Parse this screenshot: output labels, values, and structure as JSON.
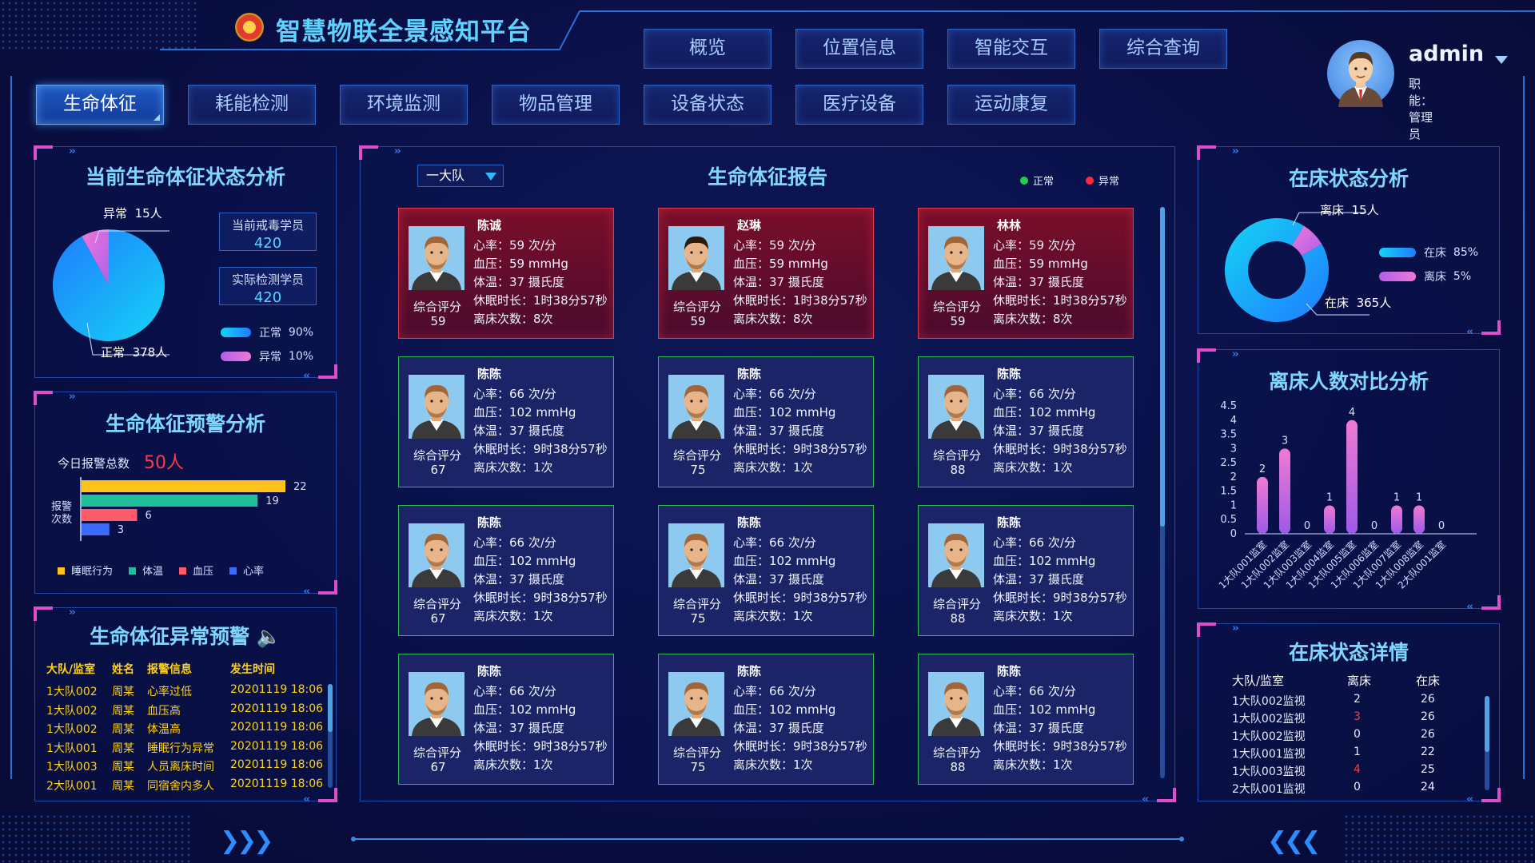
{
  "header": {
    "title": "智慧物联全景感知平台",
    "top_nav": [
      "概览",
      "位置信息",
      "智能交互",
      "综合查询"
    ],
    "sub_nav": [
      "生命体征",
      "耗能检测",
      "环境监测",
      "物品管理",
      "设备状态",
      "医疗设备",
      "运动康复"
    ],
    "active_tab": "生命体征"
  },
  "user": {
    "name": "admin",
    "role": "职能：管理员"
  },
  "vital_status": {
    "title": "当前生命体征状态分析",
    "abnormal_label": "异常",
    "abnormal_count": "15人",
    "normal_label": "正常",
    "normal_count": "378人",
    "box1_label": "当前戒毒学员",
    "box1_value": "420",
    "box2_label": "实际检测学员",
    "box2_value": "420",
    "legend": [
      {
        "name": "正常",
        "pct": "90%"
      },
      {
        "name": "异常",
        "pct": "10%"
      }
    ],
    "colors": {
      "normal": "#1aa4ff",
      "abnormal": "#d96bd6"
    }
  },
  "warning": {
    "title": "生命体征预警分析",
    "total_label": "今日报警总数",
    "total_value": "50人",
    "ylabel": "报警\n次数",
    "legend": [
      "睡眠行为",
      "体温",
      "血压",
      "心率"
    ]
  },
  "alerts": {
    "title": "生命体征异常预警",
    "headers": [
      "大队/监室",
      "姓名",
      "报警信息",
      "发生时间"
    ],
    "rows": [
      [
        "1大队002",
        "周某",
        "心率过低",
        "20201119 18:06"
      ],
      [
        "1大队002",
        "周某",
        "血压高",
        "20201119 18:06"
      ],
      [
        "1大队002",
        "周某",
        "体温高",
        "20201119 18:06"
      ],
      [
        "1大队001",
        "周某",
        "睡眠行为异常",
        "20201119 18:06"
      ],
      [
        "1大队003",
        "周某",
        "人员离床时间",
        "20201119 18:06"
      ],
      [
        "2大队001",
        "周某",
        "同宿舍内多人",
        "20201119 18:06"
      ]
    ]
  },
  "report": {
    "title": "生命体征报告",
    "team_select": "一大队",
    "legend_normal": "正常",
    "legend_abnormal": "异常",
    "cards": [
      {
        "name": "陈诚",
        "hr": "心率：59  次/分",
        "bp": "血压：59  mmHg",
        "temp": "体温：37  摄氏度",
        "sleep": "休眠时长：1时38分57秒",
        "leave": "离床次数：8次",
        "score_label": "综合评分",
        "score": "59",
        "status": "abn"
      },
      {
        "name": "赵琳",
        "hr": "心率：59  次/分",
        "bp": "血压：59  mmHg",
        "temp": "体温：37  摄氏度",
        "sleep": "休眠时长：1时38分57秒",
        "leave": "离床次数：8次",
        "score_label": "综合评分",
        "score": "59",
        "status": "abn"
      },
      {
        "name": "林林",
        "hr": "心率：59  次/分",
        "bp": "血压：59  mmHg",
        "temp": "体温：37  摄氏度",
        "sleep": "休眠时长：1时38分57秒",
        "leave": "离床次数：8次",
        "score_label": "综合评分",
        "score": "59",
        "status": "abn"
      },
      {
        "name": "陈陈",
        "hr": "心率：66  次/分",
        "bp": "血压：102  mmHg",
        "temp": "体温：37  摄氏度",
        "sleep": "休眠时长：9时38分57秒",
        "leave": "离床次数：1次",
        "score_label": "综合评分",
        "score": "67",
        "status": "norm"
      },
      {
        "name": "陈陈",
        "hr": "心率：66  次/分",
        "bp": "血压：102  mmHg",
        "temp": "体温：37  摄氏度",
        "sleep": "休眠时长：9时38分57秒",
        "leave": "离床次数：1次",
        "score_label": "综合评分",
        "score": "75",
        "status": "norm"
      },
      {
        "name": "陈陈",
        "hr": "心率：66  次/分",
        "bp": "血压：102  mmHg",
        "temp": "体温：37  摄氏度",
        "sleep": "休眠时长：9时38分57秒",
        "leave": "离床次数：1次",
        "score_label": "综合评分",
        "score": "88",
        "status": "norm"
      },
      {
        "name": "陈陈",
        "hr": "心率：66  次/分",
        "bp": "血压：102  mmHg",
        "temp": "体温：37  摄氏度",
        "sleep": "休眠时长：9时38分57秒",
        "leave": "离床次数：1次",
        "score_label": "综合评分",
        "score": "67",
        "status": "norm"
      },
      {
        "name": "陈陈",
        "hr": "心率：66  次/分",
        "bp": "血压：102  mmHg",
        "temp": "体温：37  摄氏度",
        "sleep": "休眠时长：9时38分57秒",
        "leave": "离床次数：1次",
        "score_label": "综合评分",
        "score": "75",
        "status": "norm"
      },
      {
        "name": "陈陈",
        "hr": "心率：66  次/分",
        "bp": "血压：102  mmHg",
        "temp": "体温：37  摄氏度",
        "sleep": "休眠时长：9时38分57秒",
        "leave": "离床次数：1次",
        "score_label": "综合评分",
        "score": "88",
        "status": "norm"
      },
      {
        "name": "陈陈",
        "hr": "心率：66  次/分",
        "bp": "血压：102  mmHg",
        "temp": "体温：37  摄氏度",
        "sleep": "休眠时长：9时38分57秒",
        "leave": "离床次数：1次",
        "score_label": "综合评分",
        "score": "67",
        "status": "norm"
      },
      {
        "name": "陈陈",
        "hr": "心率：66  次/分",
        "bp": "血压：102  mmHg",
        "temp": "体温：37  摄氏度",
        "sleep": "休眠时长：9时38分57秒",
        "leave": "离床次数：1次",
        "score_label": "综合评分",
        "score": "75",
        "status": "norm"
      },
      {
        "name": "陈陈",
        "hr": "心率：66  次/分",
        "bp": "血压：102  mmHg",
        "temp": "体温：37  摄氏度",
        "sleep": "休眠时长：9时38分57秒",
        "leave": "离床次数：1次",
        "score_label": "综合评分",
        "score": "88",
        "status": "norm"
      }
    ]
  },
  "bed_status": {
    "title": "在床状态分析",
    "leave_label": "离床",
    "leave_count": "15人",
    "inbed_label": "在床",
    "inbed_count": "365人",
    "legend": [
      {
        "name": "在床",
        "pct": "85%"
      },
      {
        "name": "离床",
        "pct": "5%"
      }
    ]
  },
  "leave_compare": {
    "title": "离床人数对比分析"
  },
  "bed_detail": {
    "title": "在床状态详情",
    "headers": [
      "大队/监室",
      "离床",
      "在床"
    ],
    "rows": [
      [
        "1大队002监视",
        "2",
        "26"
      ],
      [
        "1大队002监视",
        "3",
        "26"
      ],
      [
        "1大队002监视",
        "0",
        "26"
      ],
      [
        "1大队001监视",
        "1",
        "22"
      ],
      [
        "1大队003监视",
        "4",
        "25"
      ],
      [
        "2大队001监视",
        "0",
        "24"
      ]
    ],
    "highlight": [
      "1",
      "4"
    ]
  },
  "chart_data": [
    {
      "type": "pie",
      "title": "当前生命体征状态分析",
      "labels": [
        "正常",
        "异常"
      ],
      "values": [
        378,
        15
      ]
    },
    {
      "type": "bar",
      "title": "生命体征预警分析",
      "categories": [
        "睡眠行为",
        "体温",
        "血压",
        "心率"
      ],
      "values": [
        22,
        19,
        6,
        3
      ],
      "colors": [
        "#ffc21a",
        "#1fc09a",
        "#ff5a6a",
        "#3b6cff"
      ]
    },
    {
      "type": "pie",
      "title": "在床状态分析",
      "labels": [
        "在床",
        "离床"
      ],
      "values": [
        365,
        15
      ]
    },
    {
      "type": "bar",
      "title": "离床人数对比分析",
      "categories": [
        "1大队001监室",
        "1大队002监室",
        "1大队003监室",
        "1大队004监室",
        "1大队005监室",
        "1大队006监室",
        "1大队007监室",
        "1大队008监室",
        "2大队001监室"
      ],
      "values": [
        2,
        3,
        0,
        1,
        4,
        0,
        1,
        1,
        0
      ],
      "yticks": [
        "4.5",
        "4",
        "3.5",
        "3",
        "2.5",
        "2",
        "1.5",
        "1",
        "0.5",
        "0"
      ],
      "ylim": [
        0,
        4.5
      ]
    }
  ]
}
